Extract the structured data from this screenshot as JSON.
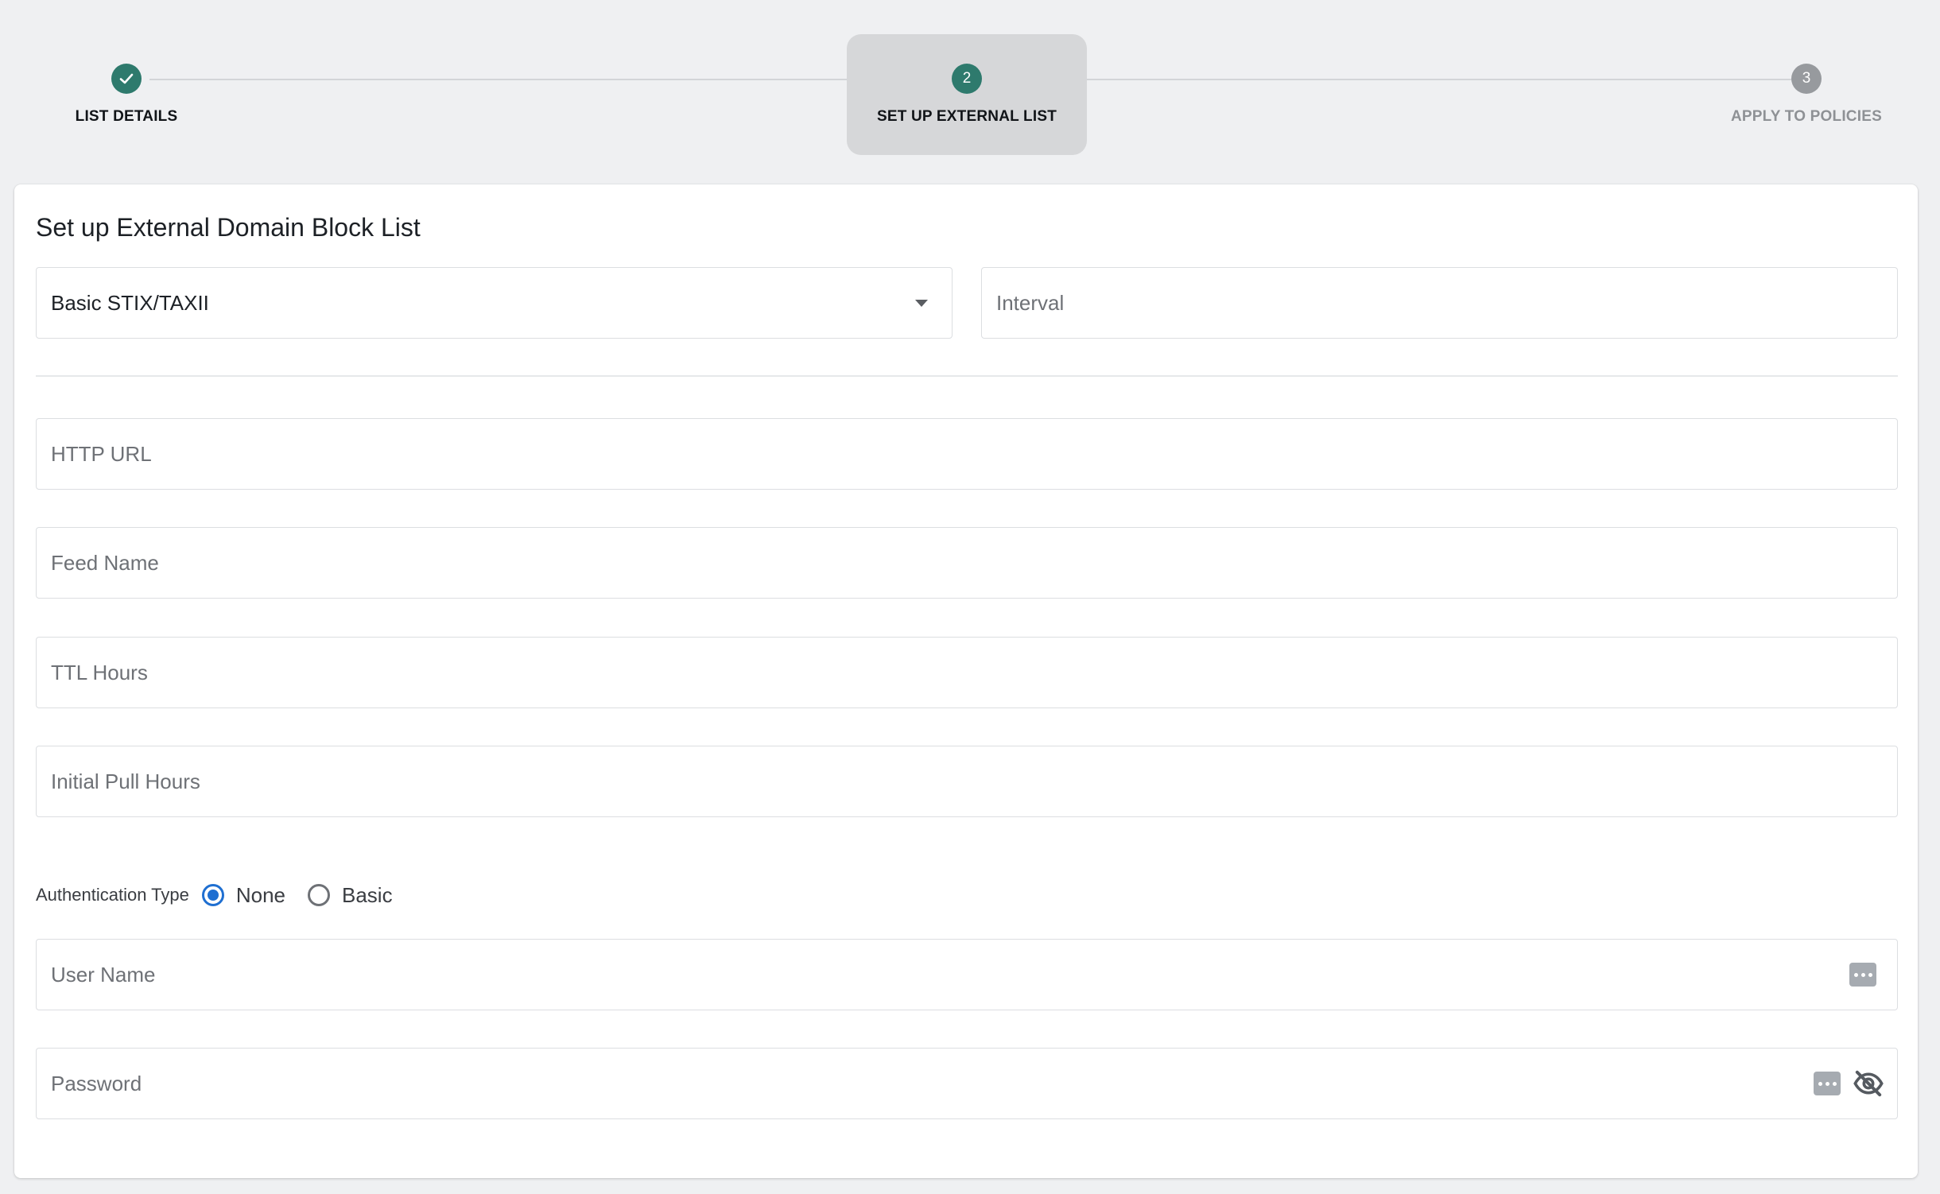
{
  "stepper": {
    "steps": [
      {
        "number": "1",
        "label": "LIST DETAILS",
        "state": "completed"
      },
      {
        "number": "2",
        "label": "SET UP EXTERNAL LIST",
        "state": "active"
      },
      {
        "number": "3",
        "label": "APPLY TO POLICIES",
        "state": "pending"
      }
    ]
  },
  "form": {
    "title": "Set up External Domain Block List",
    "feed_type": {
      "value": "Basic STIX/TAXII"
    },
    "interval": {
      "placeholder": "Interval",
      "value": ""
    },
    "http_url": {
      "placeholder": "HTTP URL",
      "value": ""
    },
    "feed_name": {
      "placeholder": "Feed Name",
      "value": ""
    },
    "ttl_hours": {
      "placeholder": "TTL Hours",
      "value": ""
    },
    "initial_pull_hours": {
      "placeholder": "Initial Pull Hours",
      "value": ""
    },
    "authentication": {
      "label": "Authentication Type",
      "options": [
        {
          "label": "None",
          "selected": true
        },
        {
          "label": "Basic",
          "selected": false
        }
      ]
    },
    "user_name": {
      "placeholder": "User Name",
      "value": ""
    },
    "password": {
      "placeholder": "Password",
      "value": ""
    }
  },
  "colors": {
    "accent_green": "#2e7a6d",
    "radio_blue": "#1f6fd1",
    "pending_gray": "#979a9e"
  }
}
